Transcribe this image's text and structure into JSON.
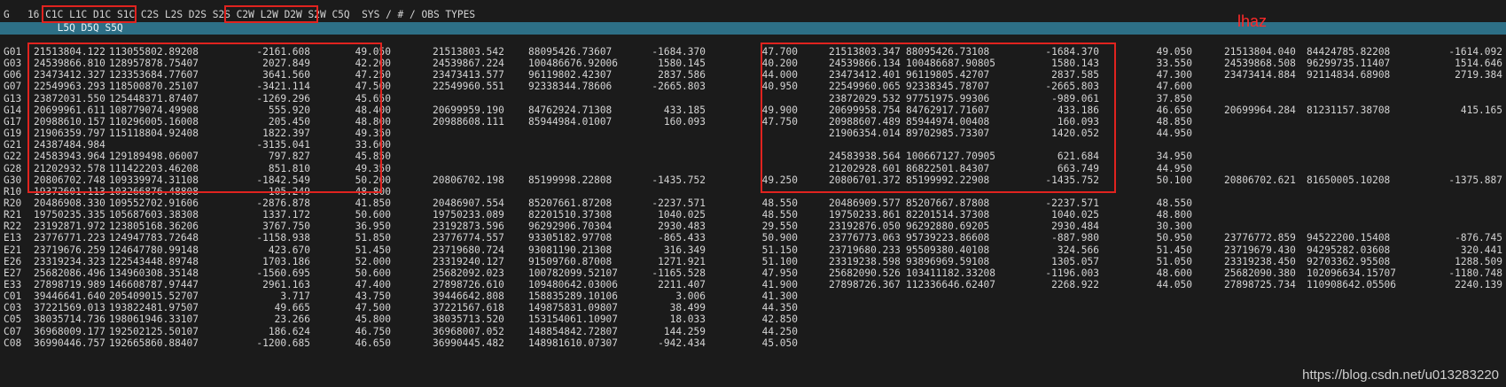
{
  "header": {
    "line1": "G   16 C1C L1C D1C S1C C2S L2S D2S S2S C2W L2W D2W S2W C5Q  SYS / # / OBS TYPES",
    "line2": "         L5Q D5Q S5Q"
  },
  "annotation": "lhaz",
  "watermark": "https://blog.csdn.net/u013283220",
  "colors": {
    "box": "#e0231f",
    "header_band": "#2d6f86",
    "background": "#1b1b1b"
  },
  "rows": [
    {
      "sat": "G01",
      "v": [
        "21513804.122",
        "113055802.89208",
        "-2161.608",
        "49.050",
        "21513803.542",
        "88095426.73607",
        "-1684.370",
        "47.700",
        "21513803.347",
        "88095426.73108",
        "-1684.370",
        "49.050",
        "21513804.040",
        "84424785.82208",
        "-1614.092"
      ]
    },
    {
      "sat": "G03",
      "v": [
        "24539866.810",
        "128957878.75407",
        "2027.849",
        "42.200",
        "24539867.224",
        "100486676.92006",
        "1580.145",
        "40.200",
        "24539866.134",
        "100486687.90805",
        "1580.143",
        "33.550",
        "24539868.508",
        "96299735.11407",
        "1514.646"
      ]
    },
    {
      "sat": "G06",
      "v": [
        "23473412.327",
        "123353684.77607",
        "3641.560",
        "47.250",
        "23473413.577",
        "96119802.42307",
        "2837.586",
        "44.000",
        "23473412.401",
        "96119805.42707",
        "2837.585",
        "47.300",
        "23473414.884",
        "92114834.68908",
        "2719.384"
      ]
    },
    {
      "sat": "G07",
      "v": [
        "22549963.293",
        "118500870.25107",
        "-3421.114",
        "47.500",
        "22549960.551",
        "92338344.78606",
        "-2665.803",
        "40.950",
        "22549960.065",
        "92338345.78707",
        "-2665.803",
        "47.600",
        "",
        "",
        ""
      ]
    },
    {
      "sat": "G13",
      "v": [
        "23872031.550",
        "125448371.87407",
        "-1269.296",
        "45.650",
        "",
        "",
        "",
        "",
        "23872029.532",
        "97751975.99306",
        "-989.061",
        "37.850",
        "",
        "",
        ""
      ]
    },
    {
      "sat": "G14",
      "v": [
        "20699961.611",
        "108779074.49908",
        "555.920",
        "48.400",
        "20699959.190",
        "84762924.71308",
        "433.185",
        "49.900",
        "20699958.754",
        "84762917.71607",
        "433.186",
        "46.650",
        "20699964.284",
        "81231157.38708",
        "415.165"
      ]
    },
    {
      "sat": "G17",
      "v": [
        "20988610.157",
        "110296005.16008",
        "205.450",
        "48.800",
        "20988608.111",
        "85944984.01007",
        "160.093",
        "47.750",
        "20988607.489",
        "85944974.00408",
        "160.093",
        "48.850",
        "",
        "",
        ""
      ]
    },
    {
      "sat": "G19",
      "v": [
        "21906359.797",
        "115118804.92408",
        "1822.397",
        "49.350",
        "",
        "",
        "",
        "",
        "21906354.014",
        "89702985.73307",
        "1420.052",
        "44.950",
        "",
        "",
        ""
      ]
    },
    {
      "sat": "G21",
      "v": [
        "24387484.984",
        "",
        "-3135.041",
        "33.600",
        "",
        "",
        "",
        "",
        "",
        "",
        "",
        "",
        "",
        "",
        ""
      ]
    },
    {
      "sat": "G22",
      "v": [
        "24583943.964",
        "129189498.06007",
        "797.827",
        "45.850",
        "",
        "",
        "",
        "",
        "24583938.564",
        "100667127.70905",
        "621.684",
        "34.950",
        "",
        "",
        ""
      ]
    },
    {
      "sat": "G28",
      "v": [
        "21202932.578",
        "111422203.46208",
        "851.810",
        "49.350",
        "",
        "",
        "",
        "",
        "21202928.601",
        "86822501.84307",
        "663.749",
        "44.950",
        "",
        "",
        ""
      ]
    },
    {
      "sat": "G30",
      "v": [
        "20806702.748",
        "109339974.31108",
        "-1842.549",
        "50.200",
        "20806702.198",
        "85199998.22808",
        "-1435.752",
        "49.250",
        "20806701.372",
        "85199992.22908",
        "-1435.752",
        "50.100",
        "20806702.621",
        "81650005.10208",
        "-1375.887"
      ]
    },
    {
      "sat": "R10",
      "v": [
        "19372601.113",
        "103266876.48808",
        "105.249",
        "48.800",
        "",
        "",
        "",
        "",
        "",
        "",
        "",
        "",
        "",
        "",
        ""
      ]
    },
    {
      "sat": "R20",
      "v": [
        "20486908.330",
        "109552702.91606",
        "-2876.878",
        "41.850",
        "20486907.554",
        "85207661.87208",
        "-2237.571",
        "48.550",
        "20486909.577",
        "85207667.87808",
        "-2237.571",
        "48.550",
        "",
        "",
        ""
      ]
    },
    {
      "sat": "R21",
      "v": [
        "19750235.335",
        "105687603.38308",
        "1337.172",
        "50.600",
        "19750233.089",
        "82201510.37308",
        "1040.025",
        "48.550",
        "19750233.861",
        "82201514.37308",
        "1040.025",
        "48.800",
        "",
        "",
        ""
      ]
    },
    {
      "sat": "R22",
      "v": [
        "23192871.972",
        "123805168.36206",
        "3767.750",
        "36.950",
        "23192873.596",
        "96292906.70304",
        "2930.483",
        "29.550",
        "23192876.050",
        "96292880.69205",
        "2930.484",
        "30.300",
        "",
        "",
        ""
      ]
    },
    {
      "sat": "E13",
      "v": [
        "23776771.223",
        "124947783.72648",
        "-1158.938",
        "51.850",
        "23776774.557",
        "93305182.97708",
        "-865.433",
        "50.900",
        "23776773.063",
        "95739223.86608",
        "-887.980",
        "50.950",
        "23776772.859",
        "94522200.15408",
        "-876.745"
      ]
    },
    {
      "sat": "E21",
      "v": [
        "23719676.259",
        "124647780.99148",
        "423.670",
        "51.450",
        "23719680.724",
        "93081190.21308",
        "316.349",
        "51.150",
        "23719680.233",
        "95509380.40108",
        "324.566",
        "51.450",
        "23719679.430",
        "94295282.03608",
        "320.441"
      ]
    },
    {
      "sat": "E26",
      "v": [
        "23319234.323",
        "122543448.89748",
        "1703.186",
        "52.000",
        "23319240.127",
        "91509760.87008",
        "1271.921",
        "51.100",
        "23319238.598",
        "93896969.59108",
        "1305.057",
        "51.050",
        "23319238.450",
        "92703362.95508",
        "1288.509"
      ]
    },
    {
      "sat": "E27",
      "v": [
        "25682086.496",
        "134960308.35148",
        "-1560.695",
        "50.600",
        "25682092.023",
        "100782099.52107",
        "-1165.528",
        "47.950",
        "25682090.526",
        "103411182.33208",
        "-1196.003",
        "48.600",
        "25682090.380",
        "102096634.15707",
        "-1180.748"
      ]
    },
    {
      "sat": "E33",
      "v": [
        "27898719.989",
        "146608787.97447",
        "2961.163",
        "47.400",
        "27898726.610",
        "109480642.03006",
        "2211.407",
        "41.900",
        "27898726.367",
        "112336646.62407",
        "2268.922",
        "44.050",
        "27898725.734",
        "110908642.05506",
        "2240.139"
      ]
    },
    {
      "sat": "C01",
      "v": [
        "39446641.640",
        "205409015.52707",
        "3.717",
        "43.750",
        "39446642.808",
        "158835289.10106",
        "3.006",
        "41.300",
        "",
        "",
        "",
        "",
        "",
        "",
        ""
      ]
    },
    {
      "sat": "C03",
      "v": [
        "37221569.013",
        "193822481.97507",
        "49.665",
        "47.500",
        "37221567.618",
        "149875831.09807",
        "38.499",
        "44.350",
        "",
        "",
        "",
        "",
        "",
        "",
        ""
      ]
    },
    {
      "sat": "C05",
      "v": [
        "38035714.736",
        "198061946.33107",
        "23.266",
        "45.800",
        "38035713.520",
        "153154061.10907",
        "18.033",
        "42.850",
        "",
        "",
        "",
        "",
        "",
        "",
        ""
      ]
    },
    {
      "sat": "C07",
      "v": [
        "36968009.177",
        "192502125.50107",
        "186.624",
        "46.750",
        "36968007.052",
        "148854842.72807",
        "144.259",
        "44.250",
        "",
        "",
        "",
        "",
        "",
        "",
        ""
      ]
    },
    {
      "sat": "C08",
      "v": [
        "36990446.757",
        "192665860.88407",
        "-1200.685",
        "46.650",
        "36990445.482",
        "148981610.07307",
        "-942.434",
        "45.050",
        "",
        "",
        "",
        "",
        "",
        "",
        ""
      ]
    }
  ]
}
